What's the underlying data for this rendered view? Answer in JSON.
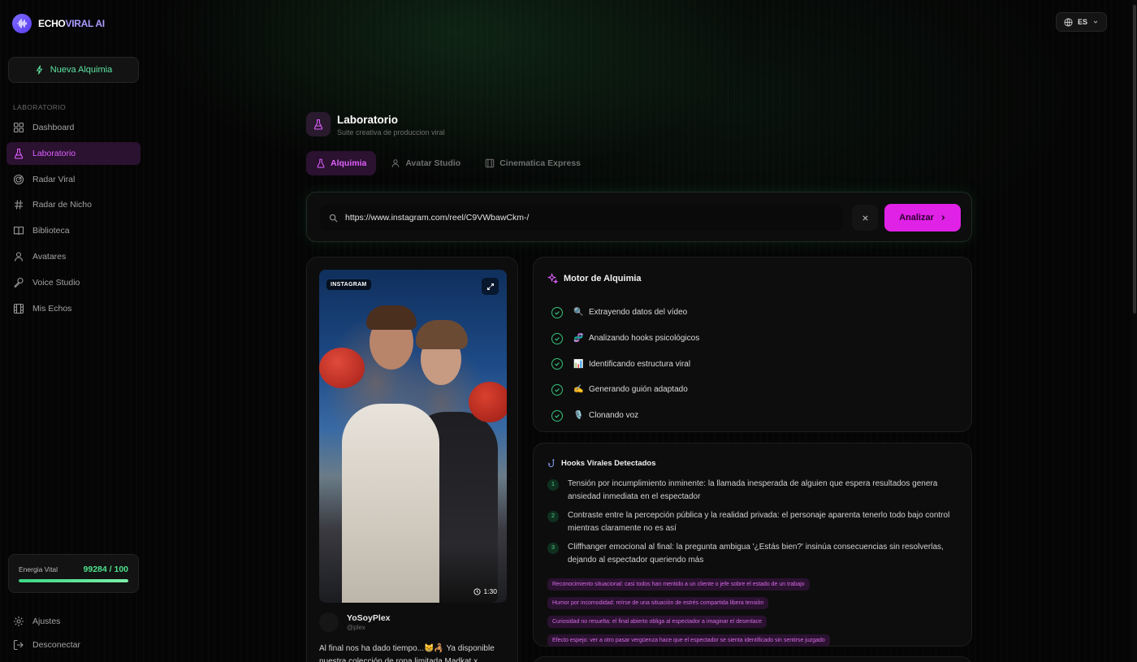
{
  "brand": {
    "name_part1": "ECHO",
    "name_part2": "VIRAL AI"
  },
  "sidebar": {
    "new_button": "Nueva Alquimia",
    "section_label": "LABORATORIO",
    "items": [
      {
        "label": "Dashboard",
        "icon": "grid-icon"
      },
      {
        "label": "Laboratorio",
        "icon": "flask-icon",
        "active": true
      },
      {
        "label": "Radar Viral",
        "icon": "radar-icon"
      },
      {
        "label": "Radar de Nicho",
        "icon": "hash-icon"
      },
      {
        "label": "Biblioteca",
        "icon": "book-icon"
      },
      {
        "label": "Avatares",
        "icon": "user-icon"
      },
      {
        "label": "Voice Studio",
        "icon": "mic-icon"
      },
      {
        "label": "Mis Echos",
        "icon": "film-icon"
      }
    ],
    "energy": {
      "label": "Energia Vital",
      "value": "99284 / 100",
      "fill_fraction": 1.0
    },
    "bottom_items": [
      {
        "label": "Ajustes",
        "icon": "gear-icon"
      },
      {
        "label": "Desconectar",
        "icon": "logout-icon"
      }
    ]
  },
  "language": {
    "label": "ES"
  },
  "header": {
    "title": "Laboratorio",
    "subtitle": "Suite creativa de produccion viral"
  },
  "tabs": [
    {
      "label": "Alquimia",
      "active": true
    },
    {
      "label": "Avatar Studio"
    },
    {
      "label": "Cinematica Express"
    }
  ],
  "url_bar": {
    "value": "https://www.instagram.com/reel/C9VWbawCkm-/",
    "analyze_label": "Analizar"
  },
  "video": {
    "platform": "INSTAGRAM",
    "duration": "1:30",
    "author_name": "YoSoyPlex",
    "author_handle": "@plex",
    "caption": "Al final nos ha dado tiempo...😸🦂 Ya disponible nuestra colección de ropa limitada Madkat x"
  },
  "motor": {
    "title": "Motor de Alquimia",
    "steps": [
      {
        "emoji": "🔍",
        "label": "Extrayendo datos del vídeo"
      },
      {
        "emoji": "🧬",
        "label": "Analizando hooks psicológicos"
      },
      {
        "emoji": "📊",
        "label": "Identificando estructura viral"
      },
      {
        "emoji": "✍️",
        "label": "Generando guión adaptado"
      },
      {
        "emoji": "🎙️",
        "label": "Clonando voz"
      }
    ]
  },
  "hooks": {
    "title": "Hooks Virales Detectados",
    "items": [
      {
        "num": "1",
        "text": "Tensión por incumplimiento inminente: la llamada inesperada de alguien que espera resultados genera ansiedad inmediata en el espectador"
      },
      {
        "num": "2",
        "text": "Contraste entre la percepción pública y la realidad privada: el personaje aparenta tenerlo todo bajo control mientras claramente no es así"
      },
      {
        "num": "3",
        "text": "Cliffhanger emocional al final: la pregunta ambigua '¿Estás bien?' insinúa consecuencias sin resolverlas, dejando al espectador queriendo más"
      }
    ],
    "tags": [
      "Reconocimiento situacional: casi todos han mentido a un cliente o jefe sobre el estado de un trabajo",
      "Humor por incomodidad: reírse de una situación de estrés compartida libera tensión",
      "Curiosidad no resuelta: el final abierto obliga al espectador a imaginar el desenlace",
      "Efecto espejo: ver a otro pasar vergüenza hace que el espectador se sienta identificado sin sentirse juzgado"
    ]
  },
  "colors": {
    "accent": "#e021e6",
    "green": "#4fe08e",
    "active_bg": "#2a1230"
  }
}
